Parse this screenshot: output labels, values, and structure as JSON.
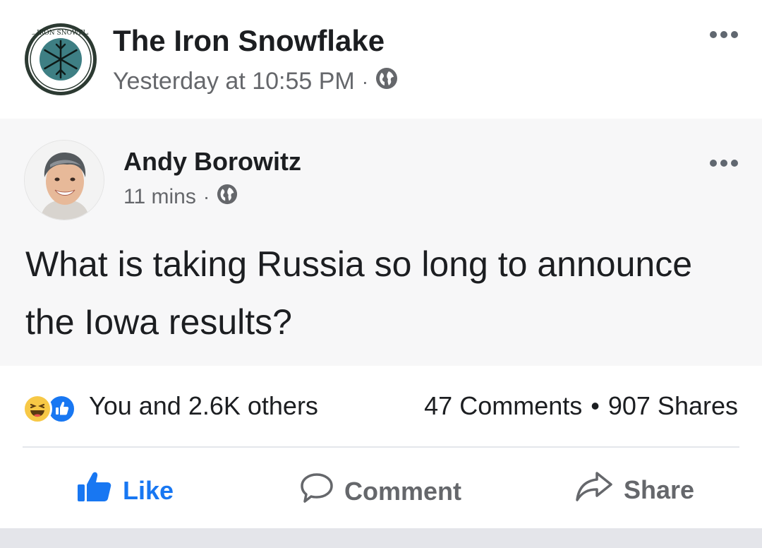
{
  "post": {
    "page_name": "The Iron Snowflake",
    "timestamp": "Yesterday at 10:55 PM",
    "separator": "·",
    "privacy_icon": "globe-icon",
    "logo_text": "THE IRON SNOWFLAKE"
  },
  "shared_post": {
    "author": "Andy Borowitz",
    "time": "11 mins",
    "separator": "·",
    "privacy_icon": "globe-icon",
    "text": "What is taking Russia so long to announce the Iowa results?"
  },
  "engagement": {
    "reaction_icons": [
      "haha-icon",
      "like-icon"
    ],
    "reaction_summary": "You and 2.6K others",
    "comments": "47 Comments",
    "separator": "•",
    "shares": "907 Shares"
  },
  "actions": {
    "like": "Like",
    "comment": "Comment",
    "share": "Share"
  },
  "colors": {
    "facebook_blue": "#1877f2",
    "text_primary": "#1c1e21",
    "text_secondary": "#65676b",
    "shared_background": "#f7f7f8",
    "logo_teal": "#3e7f84"
  }
}
